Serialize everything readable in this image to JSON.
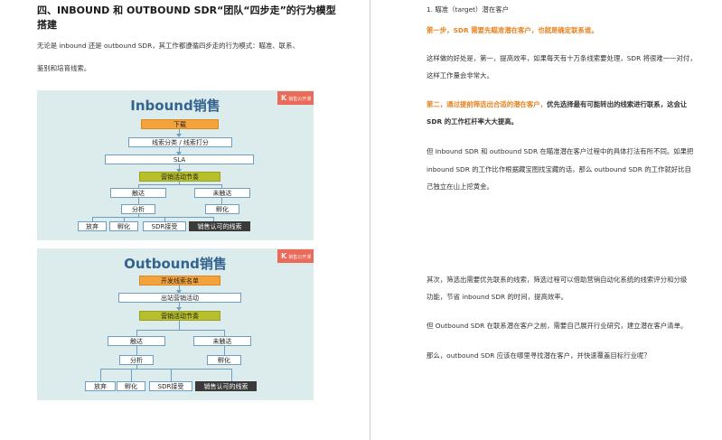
{
  "left": {
    "heading_line1": "四、INBOUND 和 OUTBOUND SDR“团队“四步走”的行为模型",
    "heading_line2": "搭建",
    "intro_line1": "无论是 inbound 还是 outbound SDR，其工作都遵循四步走的行为模式：瞄准、联系、",
    "intro_line2": "鉴别和培育线索。"
  },
  "inbound_diagram": {
    "title": "Inbound销售",
    "corner": "K",
    "corner_sub": "销售公开课",
    "n1": "下载",
    "n2": "线索分类 / 线索打分",
    "n3": "SLA",
    "n4": "营销活动节奏",
    "n5a": "触达",
    "n5b": "未触达",
    "n6a": "分析",
    "n6b": "孵化",
    "n7a": "放弃",
    "n7b": "孵化",
    "n7c": "SDR接受",
    "n7d": "销售认可的线索"
  },
  "outbound_diagram": {
    "title": "Outbound销售",
    "corner": "K",
    "corner_sub": "销售公开课",
    "n1": "开发线索名单",
    "n2": "出站营销活动",
    "n3": "营销活动节奏",
    "n4a": "触达",
    "n4b": "未触达",
    "n5a": "分析",
    "n5b": "孵化",
    "n6a": "放弃",
    "n6b": "孵化",
    "n6c": "SDR接受",
    "n6d": "销售认可的线索"
  },
  "right": {
    "item1": "1. 瞄准（target）潜在客户",
    "step1": "第一步，SDR 需要先瞄准潜在客户，也就是确定联系谁。",
    "para1_l1": "这样做的好处是，第一，提高效率，如果每天有十万条线索要处理，SDR 将很难一一对付，",
    "para1_l2": "这样工作量会非常大。",
    "step2_or": "第二，通过提前筛选出合适的潜在客户，",
    "step2_rest": "优先选择最有可能转出的线索进行联系，这会让",
    "step2_l2": "SDR 的工作杠杆率大大提高。",
    "para2_l1": "但 Inbound SDR 和 outbound SDR 在瞄准潜在客户过程中的具体打法有所不同。如果把",
    "para2_l2": "inbound SDR 的工作比作根据藏宝图找宝藏的话，那么 outbound SDR 的工作就好比自",
    "para2_l3": "己独立在山上挖黄金。",
    "para3_l1": "其次，筛选出需要优先联系的线索，筛选过程可以借助营销自动化系统的线索评分和分级",
    "para3_l2": "功能，节省 inbound SDR 的时间，提高效率。",
    "para4": "但 Outbound SDR 在联系潜在客户之前，需要自己展开行业研究，建立潜在客户清单。",
    "para5": "那么，outbound SDR 应该在哪里寻找潜在客户，并快速覆盖目标行业呢？"
  }
}
